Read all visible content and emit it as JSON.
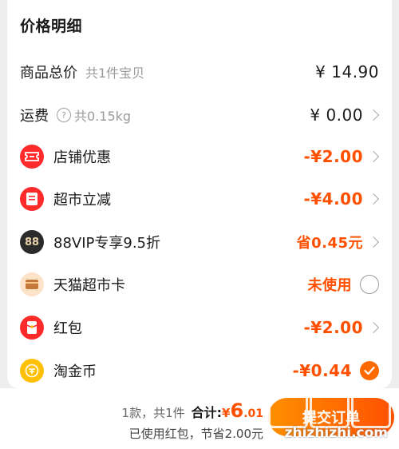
{
  "title": "价格明细",
  "rows": {
    "total": {
      "label": "商品总价",
      "sub": "共1件宝贝",
      "value": "¥ 14.90"
    },
    "shipping": {
      "label": "运费",
      "sub": "共0.15kg",
      "value": "¥ 0.00"
    },
    "store_discount": {
      "label": "店铺优惠",
      "value": "-¥2.00"
    },
    "market_cut": {
      "label": "超市立减",
      "value": "-¥4.00"
    },
    "vip": {
      "label": "88VIP专享9.5折",
      "icon_text": "88",
      "value": "省0.45元"
    },
    "card": {
      "label": "天猫超市卡",
      "value": "未使用"
    },
    "redpacket": {
      "label": "红包",
      "value": "-¥2.00"
    },
    "coins": {
      "label": "淘金币",
      "value": "-¥0.44"
    }
  },
  "footer": {
    "count": "1款，共1件",
    "total_label": "合计:",
    "total_yen": "¥",
    "total_int": "6",
    "total_dec": ".01",
    "saved": "已使用红包，节省2.00元",
    "submit_label": "提交订单"
  },
  "watermark": {
    "site": "zhizhizhi.com"
  },
  "colors": {
    "accent": "#ff5000",
    "icon_red": "#ff2b2b",
    "vip_bg": "#2b2b2b",
    "coin": "#ffc107"
  },
  "icons": [
    "help-icon",
    "coupon-icon",
    "reduce-icon",
    "vip-88-icon",
    "card-icon",
    "redpacket-icon",
    "coin-icon",
    "chevron-right-icon",
    "radio-unchecked-icon",
    "check-icon"
  ]
}
